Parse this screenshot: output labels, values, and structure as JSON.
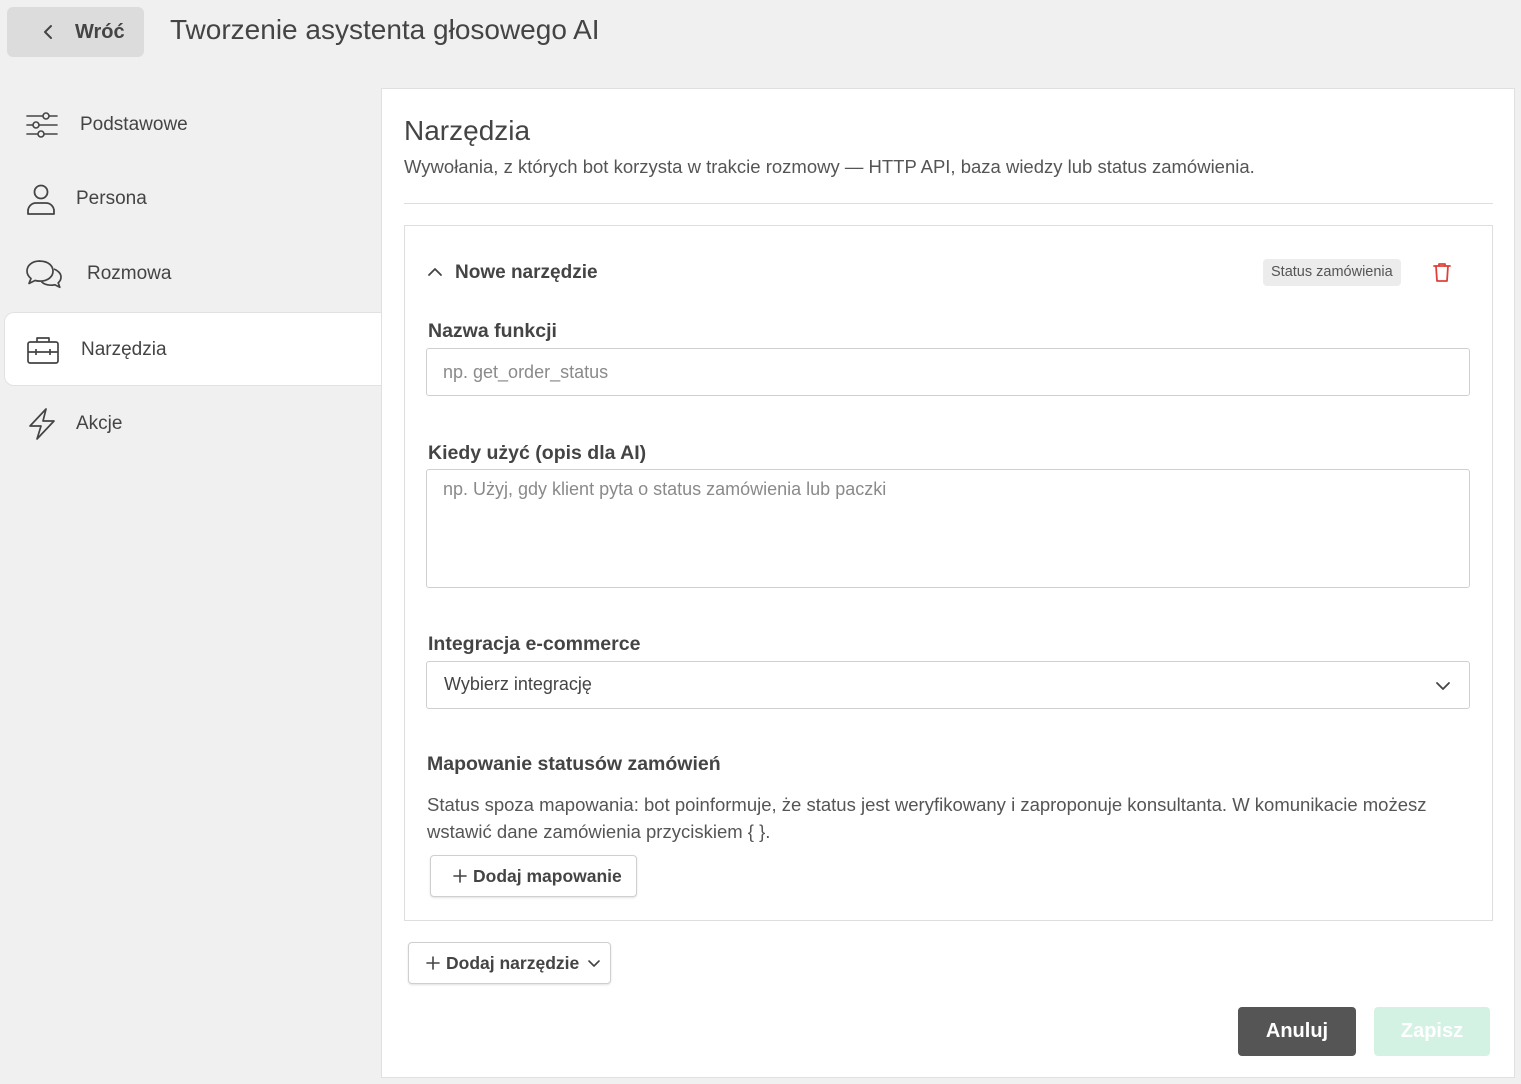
{
  "header": {
    "back_label": "Wróć",
    "title": "Tworzenie asystenta głosowego AI"
  },
  "sidebar": {
    "items": [
      {
        "label": "Podstawowe",
        "icon": "sliders-icon",
        "active": false
      },
      {
        "label": "Persona",
        "icon": "user-icon",
        "active": false
      },
      {
        "label": "Rozmowa",
        "icon": "chat-bubbles-icon",
        "active": false
      },
      {
        "label": "Narzędzia",
        "icon": "toolbox-icon",
        "active": true
      },
      {
        "label": "Akcje",
        "icon": "lightning-icon",
        "active": false
      }
    ]
  },
  "main": {
    "title": "Narzędzia",
    "description": "Wywołania, z których bot korzysta w trakcie rozmowy — HTTP API, baza wiedzy lub status zamówienia.",
    "tool": {
      "title": "Nowe narzędzie",
      "type_badge": "Status zamówienia",
      "function_name": {
        "label": "Nazwa funkcji",
        "value": "",
        "placeholder": "np. get_order_status"
      },
      "when_to_use": {
        "label": "Kiedy użyć (opis dla AI)",
        "value": "",
        "placeholder": "np. Użyj, gdy klient pyta o status zamówienia lub paczki"
      },
      "integration": {
        "label": "Integracja e-commerce",
        "selected": "Wybierz integrację"
      },
      "mapping": {
        "title": "Mapowanie statusów zamówień",
        "description": "Status spoza mapowania: bot poinformuje, że status jest weryfikowany i zaproponuje konsultanta. W komunikacie możesz wstawić dane zamówienia przyciskiem { }.",
        "add_label": "Dodaj mapowanie"
      }
    },
    "add_tool_label": "Dodaj narzędzie",
    "cancel_label": "Anuluj",
    "save_label": "Zapisz"
  },
  "colors": {
    "background": "#f0f0f0",
    "panel": "#ffffff",
    "cancel_button": "#555555",
    "save_button_disabled": "#d3f2e3",
    "delete_icon": "#e0403a"
  }
}
